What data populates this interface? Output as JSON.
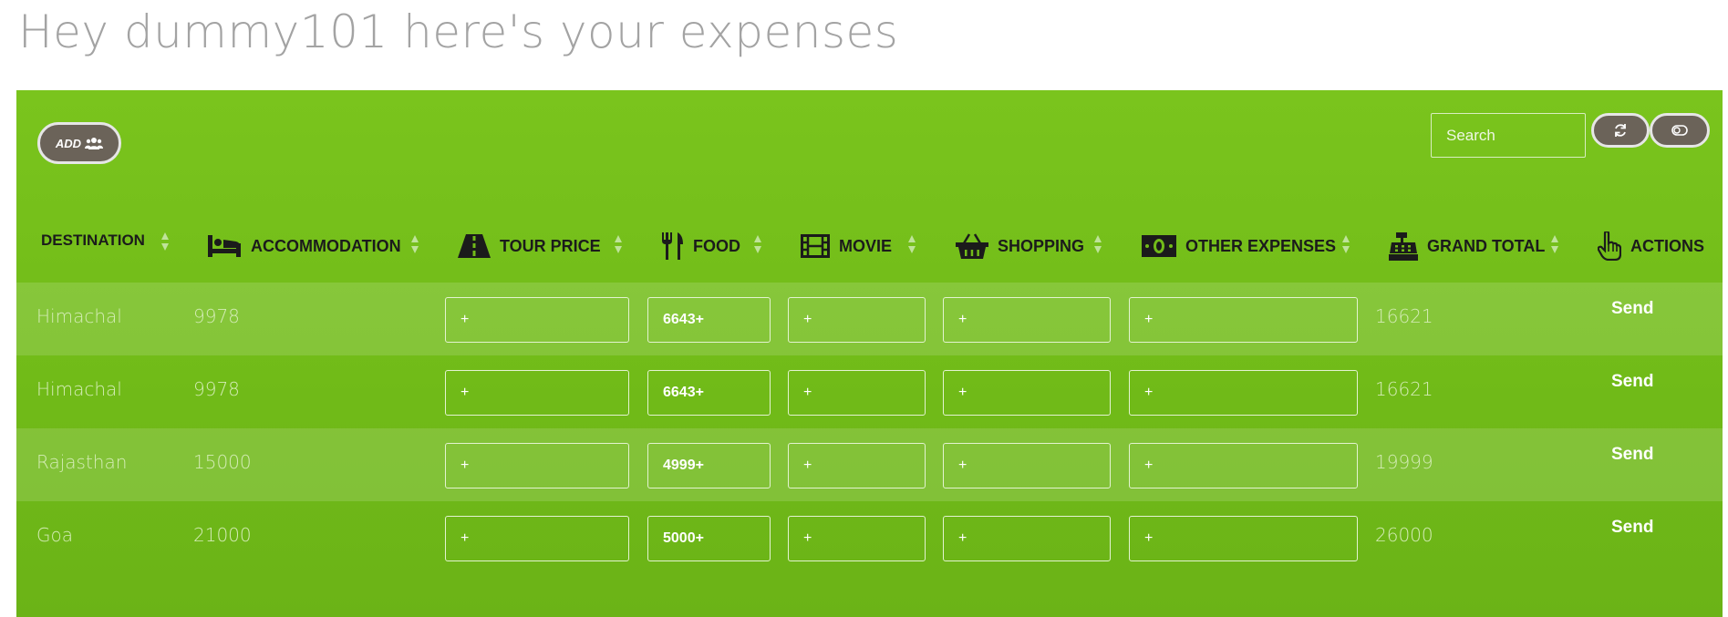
{
  "header": {
    "title": "Hey dummy101 here's your expenses"
  },
  "toolbar": {
    "add_label": "ADD",
    "search_placeholder": "Search",
    "refresh_icon": "refresh-icon",
    "toggle_icon": "toggle-icon"
  },
  "table": {
    "columns": [
      {
        "label": "DESTINATION",
        "icon": ""
      },
      {
        "label": "ACCOMMODATION",
        "icon": "bed-icon"
      },
      {
        "label": "TOUR PRICE",
        "icon": "road-icon"
      },
      {
        "label": "FOOD",
        "icon": "cutlery-icon"
      },
      {
        "label": "MOVIE",
        "icon": "film-icon"
      },
      {
        "label": "SHOPPING",
        "icon": "basket-icon"
      },
      {
        "label": "OTHER EXPENSES",
        "icon": "money-icon"
      },
      {
        "label": "GRAND TOTAL",
        "icon": "cash-register-icon"
      },
      {
        "label": "ACTIONS",
        "icon": "hand-pointer-icon"
      }
    ],
    "rows": [
      {
        "destination": "Himachal",
        "accommodation": "9978",
        "tour_price": "+",
        "food": "6643+",
        "movie": "+",
        "shopping": "+",
        "other": "+",
        "grand_total": "16621",
        "action": "Send"
      },
      {
        "destination": "Himachal",
        "accommodation": "9978",
        "tour_price": "+",
        "food": "6643+",
        "movie": "+",
        "shopping": "+",
        "other": "+",
        "grand_total": "16621",
        "action": "Send"
      },
      {
        "destination": "Rajasthan",
        "accommodation": "15000",
        "tour_price": "+",
        "food": "4999+",
        "movie": "+",
        "shopping": "+",
        "other": "+",
        "grand_total": "19999",
        "action": "Send"
      },
      {
        "destination": "Goa",
        "accommodation": "21000",
        "tour_price": "+",
        "food": "5000+",
        "movie": "+",
        "shopping": "+",
        "other": "+",
        "grand_total": "26000",
        "action": "Send"
      }
    ]
  },
  "colors": {
    "panel_green": "#72bb19",
    "button_dark": "#6b6359",
    "header_text": "#1b1b1b",
    "title_gray": "#a3a3a3"
  }
}
